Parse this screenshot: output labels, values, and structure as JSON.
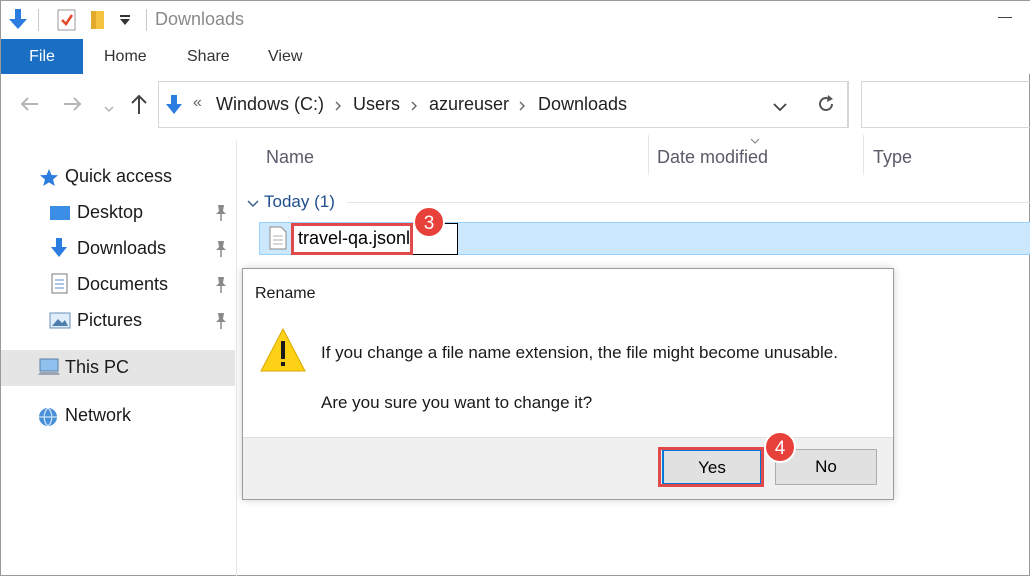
{
  "titlebar": {
    "title": "Downloads",
    "icons": [
      "downloads-arrow-icon",
      "properties-check-icon",
      "new-folder-icon",
      "customize-dropdown-icon"
    ]
  },
  "ribbon": {
    "tabs": [
      {
        "label": "File"
      },
      {
        "label": "Home"
      },
      {
        "label": "Share"
      },
      {
        "label": "View"
      }
    ]
  },
  "address": {
    "overflow": "«",
    "segments": [
      "Windows (C:)",
      "Users",
      "azureuser",
      "Downloads"
    ]
  },
  "sidebar": {
    "items": [
      {
        "label": "Quick access",
        "icon": "star-icon"
      },
      {
        "label": "Desktop",
        "icon": "desktop-icon",
        "pinned": true
      },
      {
        "label": "Downloads",
        "icon": "download-icon",
        "pinned": true
      },
      {
        "label": "Documents",
        "icon": "documents-icon",
        "pinned": true
      },
      {
        "label": "Pictures",
        "icon": "pictures-icon",
        "pinned": true
      },
      {
        "label": "This PC",
        "icon": "computer-icon",
        "selected": true
      },
      {
        "label": "Network",
        "icon": "network-icon"
      }
    ]
  },
  "columns": {
    "name": "Name",
    "date_modified": "Date modified",
    "type": "Type"
  },
  "group": {
    "label": "Today (1)"
  },
  "file": {
    "rename_value": "travel-qa.jsonl",
    "step_badge": "3"
  },
  "dialog": {
    "title": "Rename",
    "message": "If you change a file name extension, the file might become unusable.",
    "question": "Are you sure you want to change it?",
    "yes_label": "Yes",
    "no_label": "No",
    "step_badge": "4"
  },
  "colors": {
    "accent": "#1a6fc4",
    "selection": "#cce8ff",
    "highlight_red": "#e04a4a",
    "badge_red": "#e8403a"
  }
}
